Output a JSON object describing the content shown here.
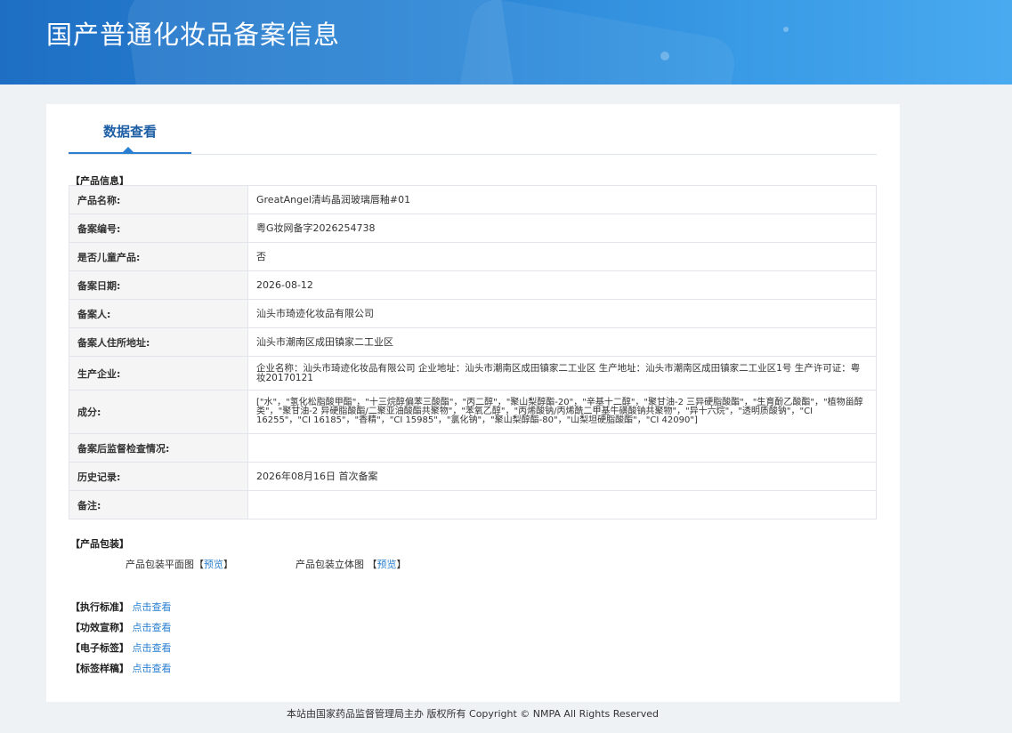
{
  "header": {
    "title": "国产普通化妆品备案信息"
  },
  "tab": {
    "label": "数据查看"
  },
  "product_info": {
    "section_label": "【产品信息】",
    "rows": [
      {
        "key": "产品名称:",
        "value": "GreatAngel清屿晶润玻璃唇釉#01"
      },
      {
        "key": "备案编号:",
        "value": "粤G妆网备字2026254738"
      },
      {
        "key": "是否儿童产品:",
        "value": "否"
      },
      {
        "key": "备案日期:",
        "value": "2026-08-12"
      },
      {
        "key": "备案人:",
        "value": "汕头市琦迹化妆品有限公司"
      },
      {
        "key": "备案人住所地址:",
        "value": "汕头市潮南区成田镇家二工业区"
      },
      {
        "key": "生产企业:",
        "value": "企业名称：汕头市琦迹化妆品有限公司 企业地址：汕头市潮南区成田镇家二工业区 生产地址：汕头市潮南区成田镇家二工业区1号 生产许可证：粤妆20170121"
      },
      {
        "key": "成分:",
        "value": "[\"水\"，\"氢化松脂酸甲酯\"，\"十三烷醇偏苯三酸酯\"，\"丙二醇\"，\"聚山梨醇酯-20\"，\"辛基十二醇\"，\"聚甘油-2 三异硬脂酸酯\"，\"生育酚乙酸酯\"，\"植物甾醇类\"，\"聚甘油-2 异硬脂酸酯/二聚亚油酸酯共聚物\"，\"苯氧乙醇\"，\"丙烯酸钠/丙烯酰二甲基牛磺酸钠共聚物\"，\"异十六烷\"，\"透明质酸钠\"，\"CI 16255\"，\"CI 16185\"，\"香精\"，\"CI 15985\"，\"氯化钠\"，\"聚山梨醇酯-80\"，\"山梨坦硬脂酸酯\"，\"CI 42090\"]"
      },
      {
        "key": "备案后监督检查情况:",
        "value": ""
      },
      {
        "key": "历史记录:",
        "value": "2026年08月16日 首次备案"
      },
      {
        "key": "备注:",
        "value": ""
      }
    ]
  },
  "packaging": {
    "section_label": "【产品包装】",
    "flat_label": "产品包装平面图",
    "solid_label": "产品包装立体图",
    "preview_link": "预览"
  },
  "standards": [
    {
      "label": "【执行标准】",
      "link": "点击查看"
    },
    {
      "label": "【功效宣称】",
      "link": "点击查看"
    },
    {
      "label": "【电子标签】",
      "link": "点击查看"
    },
    {
      "label": "【标签样稿】",
      "link": "点击查看"
    }
  ],
  "footer": {
    "text": "本站由国家药品监督管理局主办 版权所有 Copyright © NMPA All Rights Reserved"
  }
}
